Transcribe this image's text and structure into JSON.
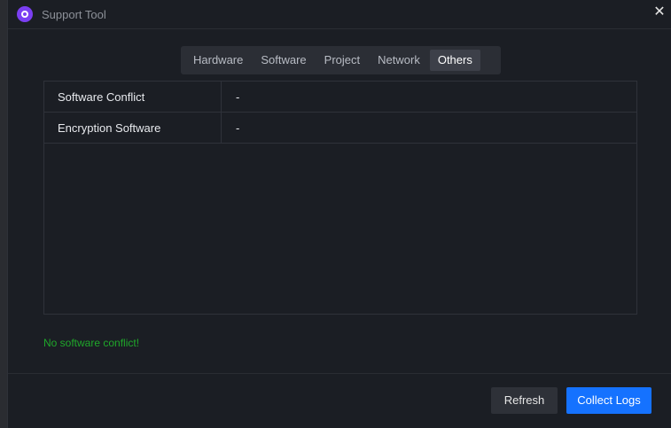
{
  "window": {
    "title": "Support Tool"
  },
  "tabs": [
    {
      "label": "Hardware",
      "active": false
    },
    {
      "label": "Software",
      "active": false
    },
    {
      "label": "Project",
      "active": false
    },
    {
      "label": "Network",
      "active": false
    },
    {
      "label": "Others",
      "active": true
    }
  ],
  "table": {
    "rows": [
      {
        "key": "Software Conflict",
        "value": "-"
      },
      {
        "key": "Encryption Software",
        "value": "-"
      }
    ]
  },
  "status_text": "No software conflict!",
  "buttons": {
    "refresh": "Refresh",
    "collect_logs": "Collect Logs"
  },
  "icons": {
    "app": "app-logo-icon",
    "close": "close-icon"
  },
  "colors": {
    "accent": "#1572ff",
    "success": "#1fa82a",
    "app_icon": "#7b3ff2"
  }
}
